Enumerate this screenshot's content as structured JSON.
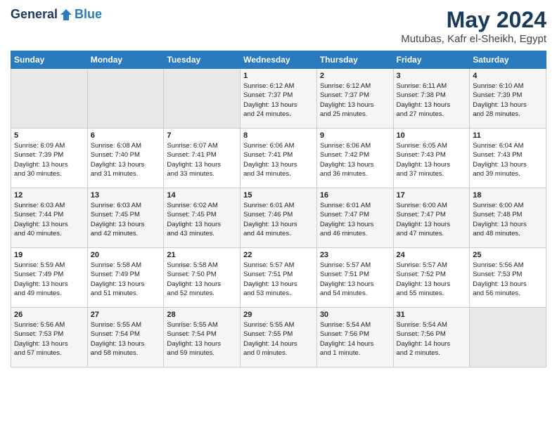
{
  "header": {
    "logo_general": "General",
    "logo_blue": "Blue",
    "month_title": "May 2024",
    "location": "Mutubas, Kafr el-Sheikh, Egypt"
  },
  "days_of_week": [
    "Sunday",
    "Monday",
    "Tuesday",
    "Wednesday",
    "Thursday",
    "Friday",
    "Saturday"
  ],
  "weeks": [
    [
      {
        "day": "",
        "info": ""
      },
      {
        "day": "",
        "info": ""
      },
      {
        "day": "",
        "info": ""
      },
      {
        "day": "1",
        "info": "Sunrise: 6:12 AM\nSunset: 7:37 PM\nDaylight: 13 hours\nand 24 minutes."
      },
      {
        "day": "2",
        "info": "Sunrise: 6:12 AM\nSunset: 7:37 PM\nDaylight: 13 hours\nand 25 minutes."
      },
      {
        "day": "3",
        "info": "Sunrise: 6:11 AM\nSunset: 7:38 PM\nDaylight: 13 hours\nand 27 minutes."
      },
      {
        "day": "4",
        "info": "Sunrise: 6:10 AM\nSunset: 7:39 PM\nDaylight: 13 hours\nand 28 minutes."
      }
    ],
    [
      {
        "day": "5",
        "info": "Sunrise: 6:09 AM\nSunset: 7:39 PM\nDaylight: 13 hours\nand 30 minutes."
      },
      {
        "day": "6",
        "info": "Sunrise: 6:08 AM\nSunset: 7:40 PM\nDaylight: 13 hours\nand 31 minutes."
      },
      {
        "day": "7",
        "info": "Sunrise: 6:07 AM\nSunset: 7:41 PM\nDaylight: 13 hours\nand 33 minutes."
      },
      {
        "day": "8",
        "info": "Sunrise: 6:06 AM\nSunset: 7:41 PM\nDaylight: 13 hours\nand 34 minutes."
      },
      {
        "day": "9",
        "info": "Sunrise: 6:06 AM\nSunset: 7:42 PM\nDaylight: 13 hours\nand 36 minutes."
      },
      {
        "day": "10",
        "info": "Sunrise: 6:05 AM\nSunset: 7:43 PM\nDaylight: 13 hours\nand 37 minutes."
      },
      {
        "day": "11",
        "info": "Sunrise: 6:04 AM\nSunset: 7:43 PM\nDaylight: 13 hours\nand 39 minutes."
      }
    ],
    [
      {
        "day": "12",
        "info": "Sunrise: 6:03 AM\nSunset: 7:44 PM\nDaylight: 13 hours\nand 40 minutes."
      },
      {
        "day": "13",
        "info": "Sunrise: 6:03 AM\nSunset: 7:45 PM\nDaylight: 13 hours\nand 42 minutes."
      },
      {
        "day": "14",
        "info": "Sunrise: 6:02 AM\nSunset: 7:45 PM\nDaylight: 13 hours\nand 43 minutes."
      },
      {
        "day": "15",
        "info": "Sunrise: 6:01 AM\nSunset: 7:46 PM\nDaylight: 13 hours\nand 44 minutes."
      },
      {
        "day": "16",
        "info": "Sunrise: 6:01 AM\nSunset: 7:47 PM\nDaylight: 13 hours\nand 46 minutes."
      },
      {
        "day": "17",
        "info": "Sunrise: 6:00 AM\nSunset: 7:47 PM\nDaylight: 13 hours\nand 47 minutes."
      },
      {
        "day": "18",
        "info": "Sunrise: 6:00 AM\nSunset: 7:48 PM\nDaylight: 13 hours\nand 48 minutes."
      }
    ],
    [
      {
        "day": "19",
        "info": "Sunrise: 5:59 AM\nSunset: 7:49 PM\nDaylight: 13 hours\nand 49 minutes."
      },
      {
        "day": "20",
        "info": "Sunrise: 5:58 AM\nSunset: 7:49 PM\nDaylight: 13 hours\nand 51 minutes."
      },
      {
        "day": "21",
        "info": "Sunrise: 5:58 AM\nSunset: 7:50 PM\nDaylight: 13 hours\nand 52 minutes."
      },
      {
        "day": "22",
        "info": "Sunrise: 5:57 AM\nSunset: 7:51 PM\nDaylight: 13 hours\nand 53 minutes."
      },
      {
        "day": "23",
        "info": "Sunrise: 5:57 AM\nSunset: 7:51 PM\nDaylight: 13 hours\nand 54 minutes."
      },
      {
        "day": "24",
        "info": "Sunrise: 5:57 AM\nSunset: 7:52 PM\nDaylight: 13 hours\nand 55 minutes."
      },
      {
        "day": "25",
        "info": "Sunrise: 5:56 AM\nSunset: 7:53 PM\nDaylight: 13 hours\nand 56 minutes."
      }
    ],
    [
      {
        "day": "26",
        "info": "Sunrise: 5:56 AM\nSunset: 7:53 PM\nDaylight: 13 hours\nand 57 minutes."
      },
      {
        "day": "27",
        "info": "Sunrise: 5:55 AM\nSunset: 7:54 PM\nDaylight: 13 hours\nand 58 minutes."
      },
      {
        "day": "28",
        "info": "Sunrise: 5:55 AM\nSunset: 7:54 PM\nDaylight: 13 hours\nand 59 minutes."
      },
      {
        "day": "29",
        "info": "Sunrise: 5:55 AM\nSunset: 7:55 PM\nDaylight: 14 hours\nand 0 minutes."
      },
      {
        "day": "30",
        "info": "Sunrise: 5:54 AM\nSunset: 7:56 PM\nDaylight: 14 hours\nand 1 minute."
      },
      {
        "day": "31",
        "info": "Sunrise: 5:54 AM\nSunset: 7:56 PM\nDaylight: 14 hours\nand 2 minutes."
      },
      {
        "day": "",
        "info": ""
      }
    ]
  ]
}
